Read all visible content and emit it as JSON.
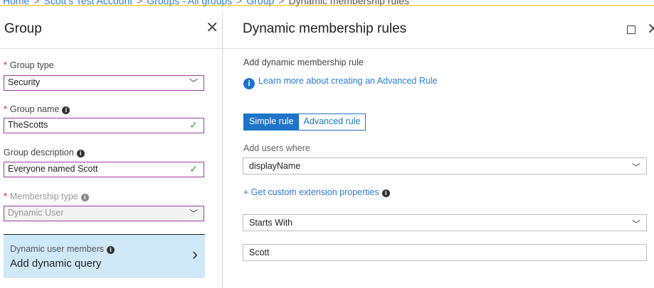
{
  "breadcrumb": {
    "items": [
      "Home",
      "Scott's Test Account",
      "Groups - All groups",
      "Group",
      "Dynamic membership rules"
    ],
    "separator": ">"
  },
  "left_blade": {
    "title": "Group",
    "close_icon": "close-icon",
    "group_type": {
      "label": "Group type",
      "required": true,
      "value": "Security"
    },
    "group_name": {
      "label": "Group name",
      "required": true,
      "value": "TheScotts"
    },
    "group_description": {
      "label": "Group description",
      "required": false,
      "value": "Everyone named Scott"
    },
    "membership_type": {
      "label": "Membership type",
      "required": true,
      "value": "Dynamic User"
    },
    "dynamic_card": {
      "label": "Dynamic user members",
      "action": "Add dynamic query"
    }
  },
  "right_blade": {
    "title": "Dynamic membership rules",
    "section_heading": "Add dynamic membership rule",
    "learn_more_link": "Learn more about creating an Advanced Rule",
    "rule_tabs": {
      "simple": "Simple rule",
      "advanced": "Advanced rule"
    },
    "add_users_where_label": "Add users where",
    "property_select": "displayName",
    "custom_extension_link": "+ Get custom extension properties",
    "operator_select": "Starts With",
    "value_input": "Scott"
  },
  "colors": {
    "accent_blue": "#1f74c9",
    "link_blue": "#2b7cd3",
    "validation_border": "#9b3c9b",
    "valid_check": "#2e9e2e",
    "required_star": "#e81123",
    "selected_card": "#cfe9f8",
    "top_accent": "#f2c200"
  }
}
